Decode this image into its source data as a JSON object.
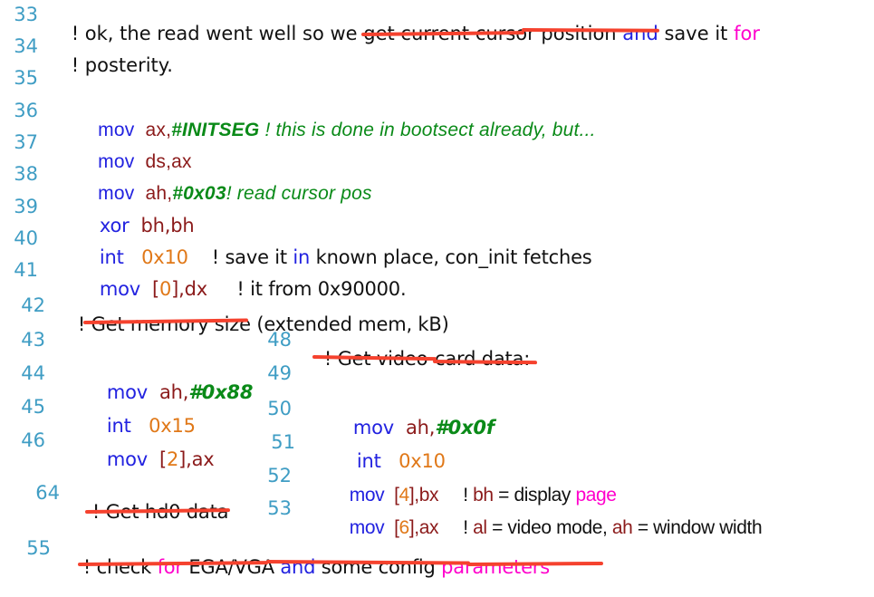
{
  "document": {
    "kind": "annotated-assembly-listing",
    "language": "x86 assembly (as86 / Linux bootstrap setup.s)",
    "background_color": "#ffffff"
  },
  "palette": {
    "line_number": "#3f9dc4",
    "mnemonic": "#2222e0",
    "register": "#8b1a1a",
    "immediate": "#0a8a18",
    "number": "#e07818",
    "comment_green": "#0a8a18",
    "comment_black": "#111111",
    "highlight_blue": "#2222e0",
    "highlight_magenta": "#ff00cc",
    "underline_red": "#f5422e"
  },
  "lines": {
    "l33": {
      "no": "33",
      "t1": "! ok, the read went well so we ",
      "t2": "get current cursor position ",
      "t3": "and",
      "t4": " save it ",
      "t5": "for"
    },
    "l34": {
      "no": "34",
      "t1": "! posterity."
    },
    "l35": {
      "no": "35",
      "t1": ""
    },
    "l36": {
      "no": "36",
      "mn": "mov",
      "op": "ax,",
      "imm": "#INITSEG",
      "cmt": " ! this is done in bootsect already, but..."
    },
    "l37": {
      "no": "37",
      "mn": "mov",
      "op": "ds,ax"
    },
    "l38": {
      "no": "38",
      "mn": "mov",
      "op": "ah,",
      "imm": "#0x03",
      "cmt": "! read cursor pos"
    },
    "l39": {
      "no": "39",
      "mn": "xor",
      "op": "bh,bh"
    },
    "l40": {
      "no": "40",
      "mn": "int",
      "num": "0x10",
      "c1": "! save it ",
      "c2": "in",
      "c3": " known place, con_init fetches"
    },
    "l41": {
      "no": "41",
      "mn": "mov",
      "b1": "[",
      "b2": "0",
      "b3": "],",
      "b4": "dx",
      "c1": "! it from 0x90000."
    },
    "l42": {
      "no": "42",
      "t1": "! ",
      "t2": "Get memory size",
      "t3": " (extended mem, kB)"
    },
    "l43": {
      "no": "43",
      "t1": ""
    },
    "l44": {
      "no": "44",
      "mn": "mov",
      "op": "ah,",
      "imm": "#0x88"
    },
    "l45": {
      "no": "45",
      "mn": "int",
      "num": "0x15"
    },
    "l46": {
      "no": "46",
      "mn": "mov",
      "b1": "[",
      "b2": "2",
      "b3": "],",
      "b4": "ax"
    },
    "l64": {
      "no": "64",
      "t1": "! ",
      "t2": "Get hd0 data"
    },
    "l48": {
      "no": "48",
      "t1": "! ",
      "t2": "Get video-card data:"
    },
    "l49": {
      "no": "49",
      "t1": ""
    },
    "l50": {
      "no": "50",
      "mn": "mov",
      "op": "ah,",
      "imm": "#0x0f"
    },
    "l51": {
      "no": "51",
      "mn": "int",
      "num": "0x10"
    },
    "l52": {
      "no": "52",
      "mn": "mov",
      "b1": "[",
      "b2": "4",
      "b3": "],",
      "b4": "bx",
      "c1": "! ",
      "c2": "bh",
      "c3": " = display ",
      "c4": "page"
    },
    "l53": {
      "no": "53",
      "mn": "mov",
      "b1": "[",
      "b2": "6",
      "b3": "],",
      "b4": "ax",
      "c1": "! ",
      "c2": "al",
      "c3": " = video mode, ",
      "c4": "ah",
      "c5": " = window width"
    },
    "l55": {
      "no": "55",
      "t1": "! check ",
      "t2": "for",
      "t3": " EGA/VGA ",
      "t4": "and",
      "t5": " some config ",
      "t6": "parameters"
    }
  },
  "annotations": {
    "underlines": [
      {
        "name": "underline-get-current-cursor-position",
        "target": "get current cursor position"
      },
      {
        "name": "underline-get-memory-size",
        "target": "Get memory size"
      },
      {
        "name": "underline-get-video-card-data",
        "target": "Get video-card data:"
      },
      {
        "name": "underline-get-hd0-data",
        "target": "Get hd0 data"
      },
      {
        "name": "underline-check-for-ega-vga",
        "target": "check for EGA/VGA and some config parameters"
      }
    ]
  }
}
